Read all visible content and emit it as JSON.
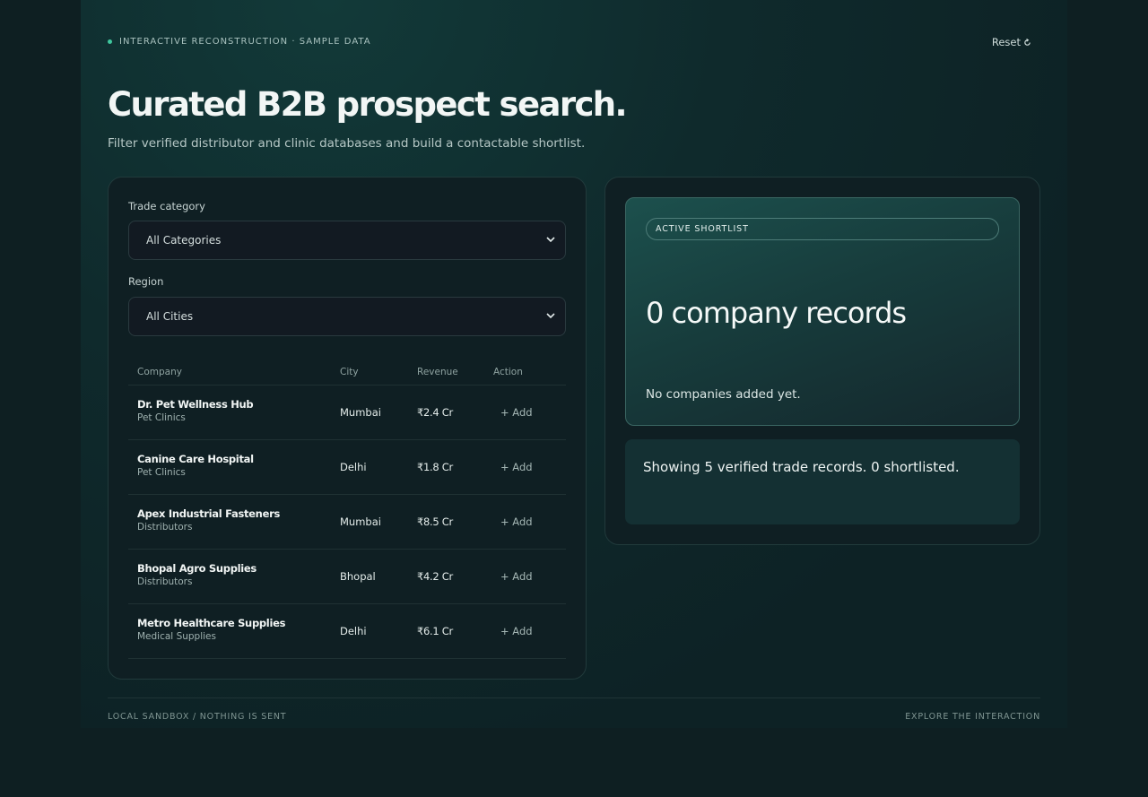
{
  "header": {
    "eyebrow": "INTERACTIVE RECONSTRUCTION · SAMPLE DATA",
    "reset_label": "Reset",
    "reset_icon": "refresh-icon"
  },
  "page": {
    "title": "Curated B2B prospect search.",
    "subtitle": "Filter verified distributor and clinic databases and build a contactable shortlist."
  },
  "filters": {
    "category_label": "Trade category",
    "category_value": "All Categories",
    "region_label": "Region",
    "region_value": "All Cities"
  },
  "table": {
    "columns": [
      "Company",
      "City",
      "Revenue",
      "Action"
    ],
    "rows": [
      {
        "name": "Dr. Pet Wellness Hub",
        "category": "Pet Clinics",
        "city": "Mumbai",
        "revenue": "₹2.4 Cr",
        "action": "+ Add"
      },
      {
        "name": "Canine Care Hospital",
        "category": "Pet Clinics",
        "city": "Delhi",
        "revenue": "₹1.8 Cr",
        "action": "+ Add"
      },
      {
        "name": "Apex Industrial Fasteners",
        "category": "Distributors",
        "city": "Mumbai",
        "revenue": "₹8.5 Cr",
        "action": "+ Add"
      },
      {
        "name": "Bhopal Agro Supplies",
        "category": "Distributors",
        "city": "Bhopal",
        "revenue": "₹4.2 Cr",
        "action": "+ Add"
      },
      {
        "name": "Metro Healthcare Supplies",
        "category": "Medical Supplies",
        "city": "Delhi",
        "revenue": "₹6.1 Cr",
        "action": "+ Add"
      }
    ]
  },
  "shortlist": {
    "badge": "ACTIVE SHORTLIST",
    "count_text": "0 company records",
    "empty_text": "No companies added yet.",
    "status_text": "Showing 5 verified trade records. 0 shortlisted."
  },
  "footer": {
    "left": "LOCAL SANDBOX / NOTHING IS SENT",
    "right": "EXPLORE THE INTERACTION"
  },
  "colors": {
    "background": "#0e1f22",
    "accent": "#3fc79e",
    "panel": "#0f1f23",
    "hero_card": "#1c504d"
  }
}
